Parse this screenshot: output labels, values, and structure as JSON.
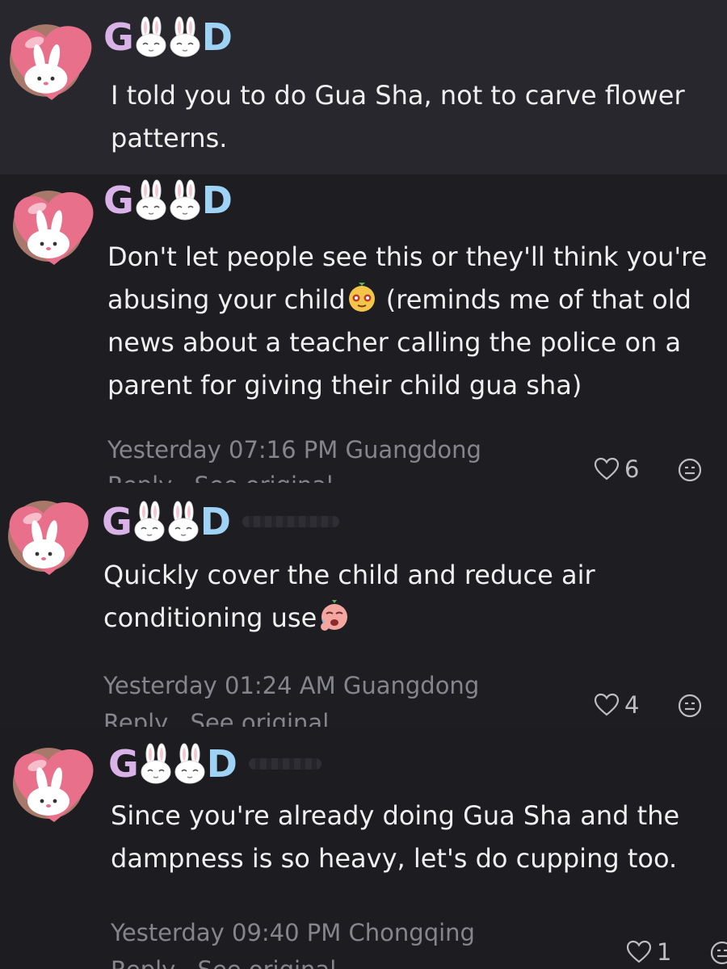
{
  "comments": [
    {
      "id": "c1",
      "username": {
        "letters": [
          "G",
          "D"
        ],
        "bunnies": 2
      },
      "text": "I told you to do Gua Sha, not to carve flower patterns."
    },
    {
      "id": "c2",
      "username": {
        "letters": [
          "G",
          "D"
        ],
        "bunnies": 2
      },
      "text_before": "Don't let people see this or they'll think you're abusing your child",
      "emoji": "cheeky-face-emoji",
      "text_after": " (reminds me of that old news about a teacher calling the police on a parent for giving their child gua sha)",
      "time": "Yesterday 07:16 PM",
      "location": "Guangdong",
      "likes": "6",
      "reply_label": "Reply",
      "see_original_label": "See original"
    },
    {
      "id": "c3",
      "username": {
        "letters": [
          "G",
          "D"
        ],
        "bunnies": 2
      },
      "text_before": "Quickly cover the child and reduce air conditioning use",
      "emoji": "crying-face-emoji",
      "time": "Yesterday 01:24 AM",
      "location": "Guangdong",
      "likes": "4",
      "reply_label": "Reply",
      "see_original_label": "See original"
    },
    {
      "id": "c4",
      "username": {
        "letters": [
          "G",
          "D"
        ],
        "bunnies": 2
      },
      "text": "Since you're already doing Gua Sha and the dampness is so heavy, let's do cupping too.",
      "time": "Yesterday 09:40 PM",
      "location": "Chongqing",
      "likes": "1",
      "reply_label": "Reply",
      "see_original_label": "See original"
    }
  ],
  "colors": {
    "background": "#1c1c21",
    "highlighted_background": "#27272d",
    "avatar_heart": "#e8708a",
    "username_g": "#d9b3e8",
    "username_d": "#9fd3f5",
    "meta_text": "#85858c"
  },
  "icons": [
    "heart-avatar-icon",
    "bunny-icon",
    "like-heart-icon",
    "emoji-reaction-icon"
  ]
}
